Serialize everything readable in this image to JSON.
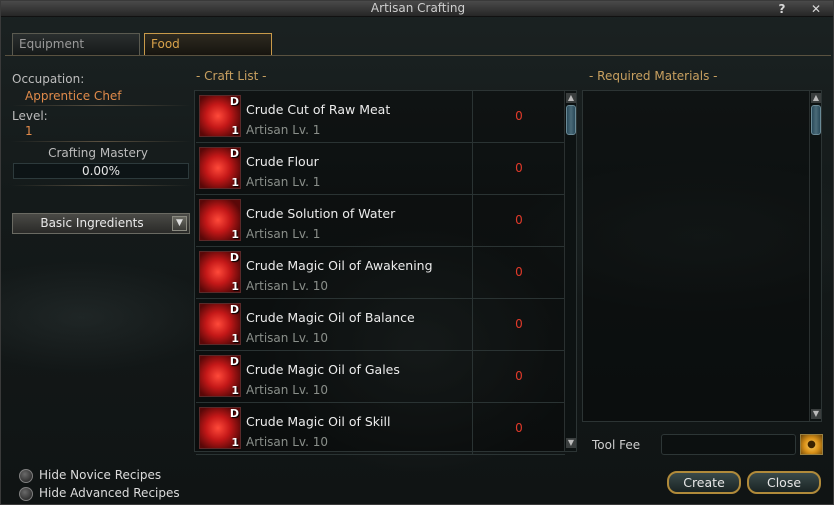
{
  "window": {
    "title": "Artisan Crafting",
    "help": "?",
    "close": "✕"
  },
  "tabs": [
    {
      "label": "Equipment"
    },
    {
      "label": "Food"
    }
  ],
  "left_panel": {
    "occupation_label": "Occupation:",
    "occupation_value": "Apprentice Chef",
    "level_label": "Level:",
    "level_value": "1",
    "mastery_label": "Crafting Mastery",
    "mastery_text": "0.00%",
    "mastery_fraction": 0.0,
    "category": "Basic Ingredients"
  },
  "craft_list": {
    "heading": "- Craft List -",
    "items": [
      {
        "name": "Crude Cut of Raw Meat",
        "level": "Artisan Lv. 1",
        "count": "0",
        "badge": "D",
        "qty": "1",
        "icon": "raw-meat-icon"
      },
      {
        "name": "Crude Flour",
        "level": "Artisan Lv. 1",
        "count": "0",
        "badge": "D",
        "qty": "1",
        "icon": "flour-icon"
      },
      {
        "name": "Crude Solution of Water",
        "level": "Artisan Lv. 1",
        "count": "0",
        "badge": "",
        "qty": "1",
        "icon": "water-flask-icon"
      },
      {
        "name": "Crude Magic Oil of Awakening",
        "level": "Artisan Lv. 10",
        "count": "0",
        "badge": "D",
        "qty": "1",
        "icon": "magic-oil-icon"
      },
      {
        "name": "Crude Magic Oil of Balance",
        "level": "Artisan Lv. 10",
        "count": "0",
        "badge": "D",
        "qty": "1",
        "icon": "magic-oil-icon"
      },
      {
        "name": "Crude Magic Oil of Gales",
        "level": "Artisan Lv. 10",
        "count": "0",
        "badge": "D",
        "qty": "1",
        "icon": "magic-oil-icon"
      },
      {
        "name": "Crude Magic Oil of Skill",
        "level": "Artisan Lv. 10",
        "count": "0",
        "badge": "D",
        "qty": "1",
        "icon": "magic-oil-icon"
      }
    ]
  },
  "required_materials": {
    "heading": "- Required Materials -"
  },
  "tool_fee": {
    "label": "Tool Fee",
    "value": ""
  },
  "options": [
    {
      "label": "Hide Novice Recipes"
    },
    {
      "label": "Hide Advanced Recipes"
    }
  ],
  "buttons": {
    "create": "Create",
    "close": "Close"
  },
  "colors": {
    "accent": "#c8a060",
    "count_red": "#e23a2a",
    "occupation": "#e08a4a",
    "item_icon": "#c41818"
  }
}
